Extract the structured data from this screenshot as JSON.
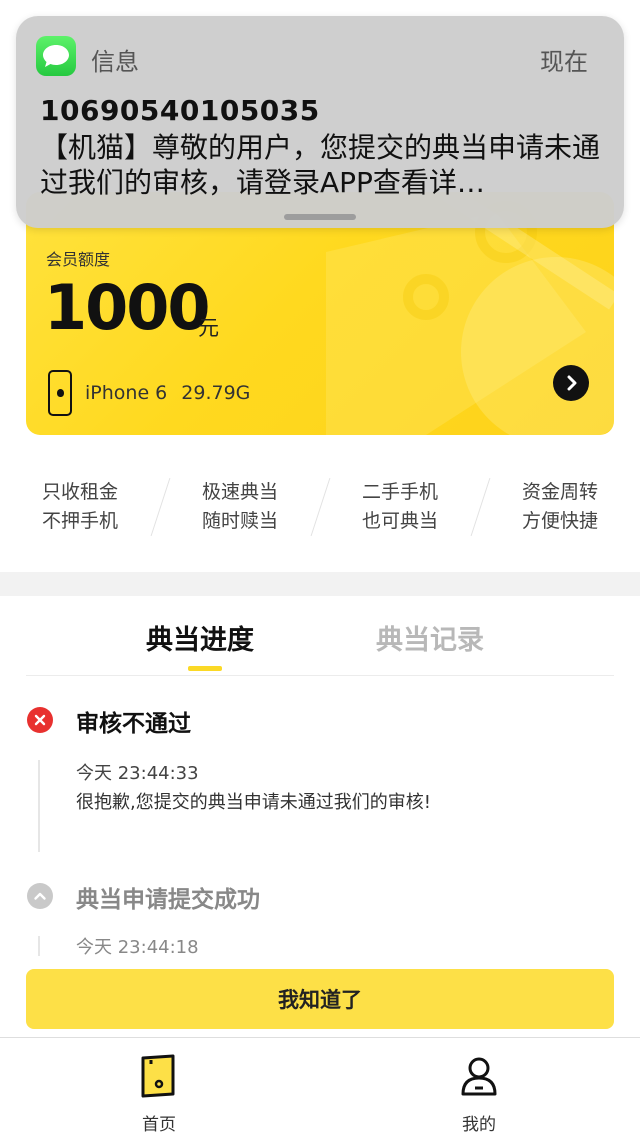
{
  "notification": {
    "app_name": "信息",
    "time": "现在",
    "sender": "10690540105035",
    "body": "【机猫】尊敬的用户，您提交的典当申请未通过我们的审核，请登录APP查看详…"
  },
  "card": {
    "label": "会员额度",
    "amount": "1000",
    "unit": "元",
    "device_model": "iPhone 6",
    "device_storage": "29.79G"
  },
  "features": [
    {
      "line1": "只收租金",
      "line2": "不押手机"
    },
    {
      "line1": "极速典当",
      "line2": "随时赎当"
    },
    {
      "line1": "二手手机",
      "line2": "也可典当"
    },
    {
      "line1": "资金周转",
      "line2": "方便快捷"
    }
  ],
  "tabs": {
    "active": "典当进度",
    "inactive": "典当记录"
  },
  "timeline": [
    {
      "status": "审核不通过",
      "time": "今天 23:44:33",
      "message": "很抱歉,您提交的典当申请未通过我们的审核!"
    },
    {
      "status": "典当申请提交成功",
      "time": "今天 23:44:18"
    }
  ],
  "button": {
    "label": "我知道了"
  },
  "bottom_nav": [
    {
      "label": "首页",
      "icon": "home-phone-icon"
    },
    {
      "label": "我的",
      "icon": "profile-icon"
    }
  ],
  "colors": {
    "accent": "#fde047",
    "error": "#e8312f",
    "card": "#ffdd2a"
  }
}
